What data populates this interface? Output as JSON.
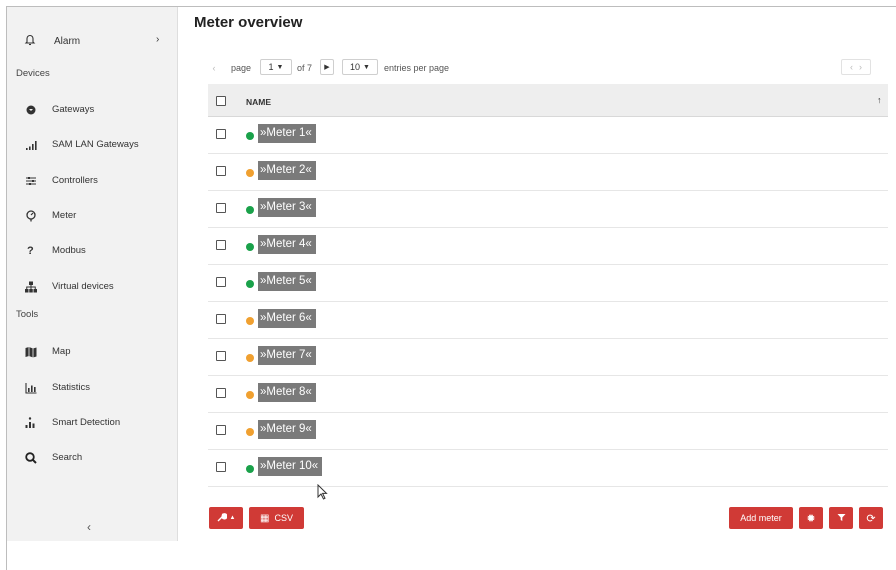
{
  "sidebar": {
    "alarm_label": "Alarm",
    "sections": {
      "devices": "Devices",
      "tools": "Tools"
    },
    "devices_items": [
      {
        "label": "Gateways",
        "icon": "gateway-icon"
      },
      {
        "label": "SAM LAN Gateways",
        "icon": "signal-bars-icon"
      },
      {
        "label": "Controllers",
        "icon": "sliders-icon"
      },
      {
        "label": "Meter",
        "icon": "meter-icon"
      },
      {
        "label": "Modbus",
        "icon": "question-icon"
      },
      {
        "label": "Virtual devices",
        "icon": "hierarchy-icon"
      }
    ],
    "tools_items": [
      {
        "label": "Map",
        "icon": "map-icon"
      },
      {
        "label": "Statistics",
        "icon": "bar-chart-icon"
      },
      {
        "label": "Smart Detection",
        "icon": "detection-icon"
      },
      {
        "label": "Search",
        "icon": "search-icon"
      }
    ],
    "collapse_glyph": "‹"
  },
  "main": {
    "title": "Meter overview",
    "pagination": {
      "page_label": "page",
      "current_page": "1",
      "of_label": "of 7",
      "per_page": "10",
      "entries_label": "entries per page"
    },
    "table": {
      "column_name": "NAME",
      "rows": [
        {
          "name": "»Meter 1«",
          "status": "green"
        },
        {
          "name": "»Meter 2«",
          "status": "orange"
        },
        {
          "name": "»Meter 3«",
          "status": "green"
        },
        {
          "name": "»Meter 4«",
          "status": "green"
        },
        {
          "name": "»Meter 5«",
          "status": "green"
        },
        {
          "name": "»Meter 6«",
          "status": "orange"
        },
        {
          "name": "»Meter 7«",
          "status": "orange"
        },
        {
          "name": "»Meter 8«",
          "status": "orange"
        },
        {
          "name": "»Meter 9«",
          "status": "orange"
        },
        {
          "name": "»Meter 10«",
          "status": "green"
        }
      ]
    },
    "footer": {
      "csv_label": "CSV",
      "add_meter_label": "Add meter"
    }
  },
  "colors": {
    "accent_red": "#d03a36",
    "status_green": "#1aa14a",
    "status_orange": "#f0a030"
  }
}
